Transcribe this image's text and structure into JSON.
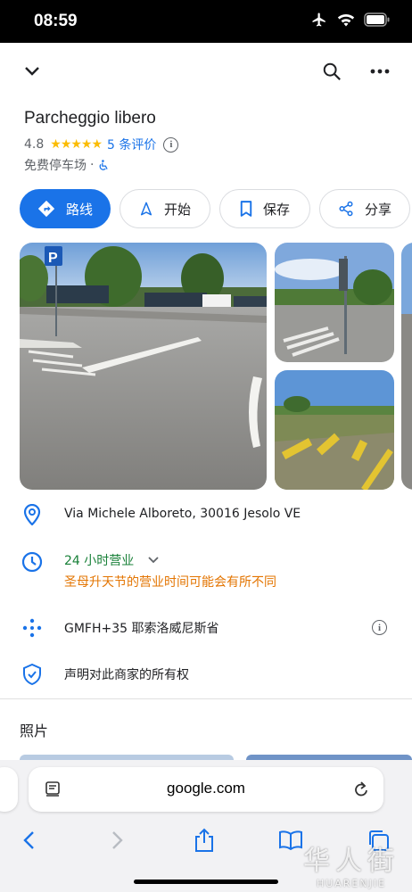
{
  "status_bar": {
    "time": "08:59"
  },
  "place": {
    "name": "Parcheggio libero",
    "rating": "4.8",
    "stars": "★★★★★",
    "reviews": "5 条评价",
    "info_glyph": "i",
    "category": "免费停车场",
    "separator": "·",
    "accessibility_icon": "wheelchair-icon"
  },
  "actions": [
    {
      "label": "路线",
      "icon": "directions-icon"
    },
    {
      "label": "开始",
      "icon": "navigation-arrow-icon"
    },
    {
      "label": "保存",
      "icon": "bookmark-icon"
    },
    {
      "label": "分享",
      "icon": "share-icon"
    }
  ],
  "details": {
    "address": "Via Michele Alboreto, 30016 Jesolo VE",
    "hours": "24 小时营业",
    "hours_warning": "圣母升天节的营业时间可能会有所不同",
    "plus_code": "GMFH+35 耶索洛威尼斯省",
    "claim": "声明对此商家的所有权"
  },
  "sections": {
    "photos_title": "照片"
  },
  "browser": {
    "url": "google.com"
  },
  "watermark": {
    "main": "华人街",
    "sub": "HUARENJIE"
  },
  "colors": {
    "accent": "#1a73e8",
    "open_green": "#188038",
    "warning_orange": "#e37400",
    "star": "#fbbc04"
  }
}
